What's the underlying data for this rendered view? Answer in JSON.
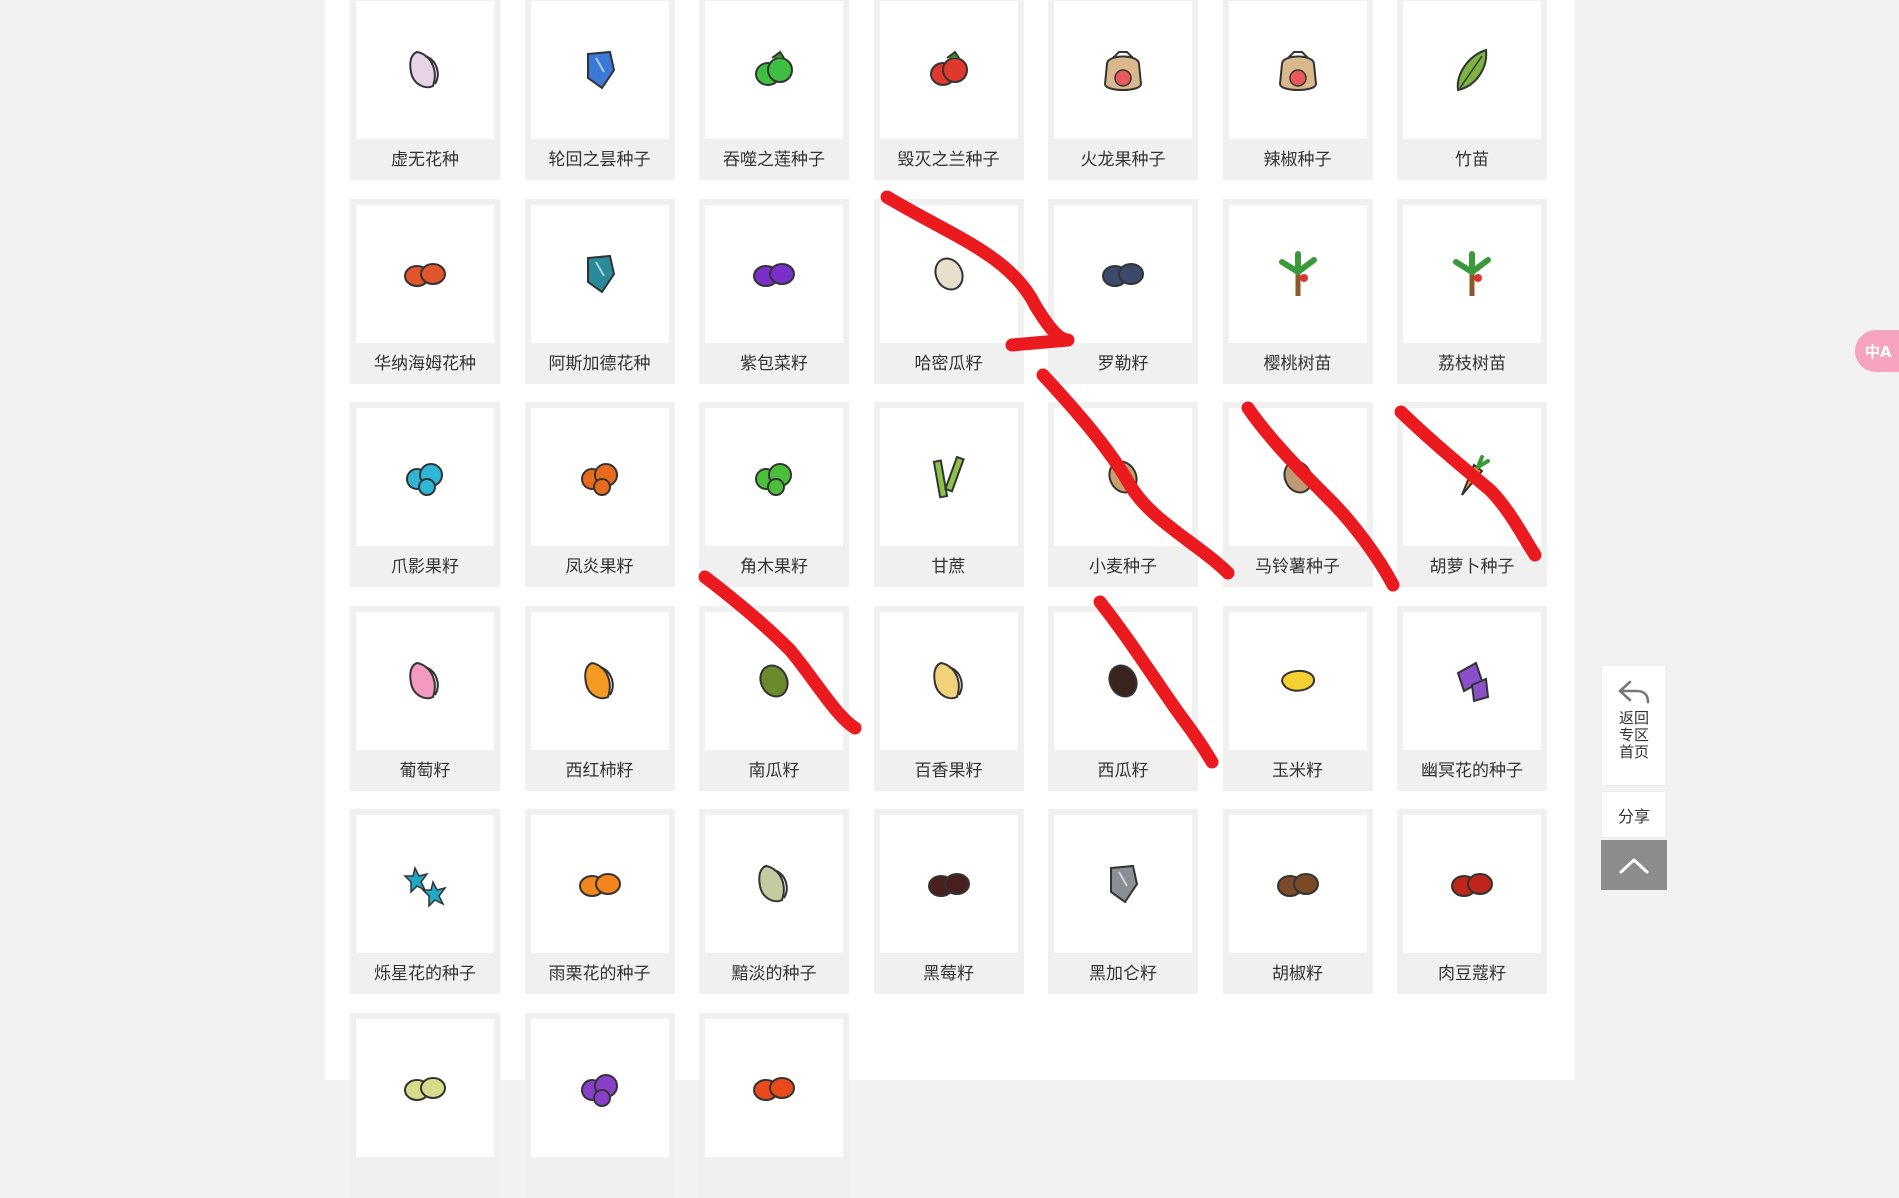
{
  "items": [
    {
      "name": "虚无花种",
      "icon": "seed-icon",
      "color": "#e6d3e6",
      "shape": "petal"
    },
    {
      "name": "轮回之昙种子",
      "icon": "seed-icon",
      "color": "#3a7ad6",
      "shape": "gem"
    },
    {
      "name": "吞噬之莲种子",
      "icon": "seed-icon",
      "color": "#3fbf3f",
      "shape": "leafy"
    },
    {
      "name": "毁灭之兰种子",
      "icon": "seed-icon",
      "color": "#e0392b",
      "shape": "leafy"
    },
    {
      "name": "火龙果种子",
      "icon": "seed-bag-icon",
      "color": "#d9b98c",
      "shape": "bag"
    },
    {
      "name": "辣椒种子",
      "icon": "seed-bag-icon",
      "color": "#d9b98c",
      "shape": "bag"
    },
    {
      "name": "竹苗",
      "icon": "leaf-icon",
      "color": "#7cb342",
      "shape": "leaf"
    },
    {
      "name": "华纳海姆花种",
      "icon": "seed-icon",
      "color": "#e0552b",
      "shape": "pair"
    },
    {
      "name": "阿斯加德花种",
      "icon": "seed-icon",
      "color": "#2a8a9a",
      "shape": "gem"
    },
    {
      "name": "紫包菜籽",
      "icon": "seed-icon",
      "color": "#7b2fc9",
      "shape": "pair"
    },
    {
      "name": "哈密瓜籽",
      "icon": "seed-icon",
      "color": "#e8e0cc",
      "shape": "oval"
    },
    {
      "name": "罗勒籽",
      "icon": "seed-icon",
      "color": "#3b4a6b",
      "shape": "pair"
    },
    {
      "name": "樱桃树苗",
      "icon": "sapling-icon",
      "color": "#8b5a2b",
      "shape": "tree"
    },
    {
      "name": "荔枝树苗",
      "icon": "sapling-icon",
      "color": "#8b5a2b",
      "shape": "tree"
    },
    {
      "name": "爪影果籽",
      "icon": "seed-icon",
      "color": "#2fb5d6",
      "shape": "cluster"
    },
    {
      "name": "凤炎果籽",
      "icon": "seed-icon",
      "color": "#e86a1c",
      "shape": "cluster"
    },
    {
      "name": "角木果籽",
      "icon": "seed-icon",
      "color": "#4cbf3a",
      "shape": "cluster"
    },
    {
      "name": "甘蔗",
      "icon": "sugarcane-icon",
      "color": "#8bc34a",
      "shape": "cane"
    },
    {
      "name": "小麦种子",
      "icon": "seed-icon",
      "color": "#c8a06a",
      "shape": "oval"
    },
    {
      "name": "马铃薯种子",
      "icon": "seed-icon",
      "color": "#c09a74",
      "shape": "oval"
    },
    {
      "name": "胡萝卜种子",
      "icon": "carrot-icon",
      "color": "#f28c28",
      "shape": "carrot"
    },
    {
      "name": "葡萄籽",
      "icon": "seed-icon",
      "color": "#f29ac0",
      "shape": "petal"
    },
    {
      "name": "西红柿籽",
      "icon": "seed-icon",
      "color": "#f59a23",
      "shape": "petal"
    },
    {
      "name": "南瓜籽",
      "icon": "seed-icon",
      "color": "#6b8a2b",
      "shape": "oval"
    },
    {
      "name": "百香果籽",
      "icon": "seed-icon",
      "color": "#f2d27a",
      "shape": "petal"
    },
    {
      "name": "西瓜籽",
      "icon": "seed-icon",
      "color": "#3a2420",
      "shape": "oval"
    },
    {
      "name": "玉米籽",
      "icon": "seed-icon",
      "color": "#f5d030",
      "shape": "blob"
    },
    {
      "name": "幽冥花的种子",
      "icon": "seed-icon",
      "color": "#8a4fc9",
      "shape": "crystal"
    },
    {
      "name": "烁星花的种子",
      "icon": "seed-icon",
      "color": "#1fa8c9",
      "shape": "star"
    },
    {
      "name": "雨栗花的种子",
      "icon": "seed-icon",
      "color": "#f2851c",
      "shape": "pair"
    },
    {
      "name": "黯淡的种子",
      "icon": "seed-icon",
      "color": "#c3cca0",
      "shape": "petal"
    },
    {
      "name": "黑莓籽",
      "icon": "seed-icon",
      "color": "#4a1f1f",
      "shape": "pair"
    },
    {
      "name": "黑加仑籽",
      "icon": "seed-icon",
      "color": "#8a8f96",
      "shape": "gem"
    },
    {
      "name": "胡椒籽",
      "icon": "seed-icon",
      "color": "#7a4a28",
      "shape": "pair"
    },
    {
      "name": "肉豆蔻籽",
      "icon": "seed-icon",
      "color": "#c0251c",
      "shape": "pair"
    },
    {
      "name": "",
      "icon": "seed-icon",
      "color": "#d6dc8a",
      "shape": "pair"
    },
    {
      "name": "",
      "icon": "seed-icon",
      "color": "#8a3fc9",
      "shape": "cluster"
    },
    {
      "name": "",
      "icon": "seed-icon",
      "color": "#e84a1c",
      "shape": "pair"
    }
  ],
  "side_tools": {
    "back_home_label": "返回专区首页",
    "share_label": "分享",
    "back_icon": "reply-arrow-icon",
    "top_icon": "chevron-up-icon"
  },
  "translate_button": {
    "label": "中A",
    "icon": "translate-icon"
  }
}
